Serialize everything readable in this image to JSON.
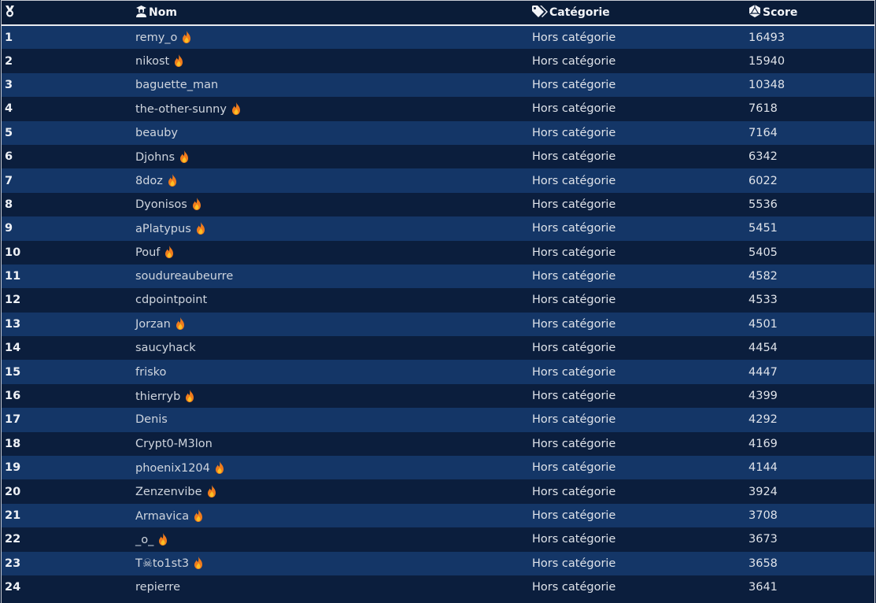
{
  "header": {
    "rank_icon": "medal-icon",
    "name_label": "Nom",
    "name_icon": "user-graduate-icon",
    "category_label": "Catégorie",
    "category_icon": "tags-icon",
    "score_label": "Score",
    "score_icon": "dice-d20-icon"
  },
  "colors": {
    "row_odd": "#143667",
    "row_even": "#0b1e3d",
    "fire": "#f07b1c"
  },
  "rows": [
    {
      "rank": "1",
      "name": "remy_o",
      "fire": true,
      "category": "Hors catégorie",
      "score": "16493"
    },
    {
      "rank": "2",
      "name": "nikost",
      "fire": true,
      "category": "Hors catégorie",
      "score": "15940"
    },
    {
      "rank": "3",
      "name": "baguette_man",
      "fire": false,
      "category": "Hors catégorie",
      "score": "10348"
    },
    {
      "rank": "4",
      "name": "the-other-sunny",
      "fire": true,
      "category": "Hors catégorie",
      "score": "7618"
    },
    {
      "rank": "5",
      "name": "beauby",
      "fire": false,
      "category": "Hors catégorie",
      "score": "7164"
    },
    {
      "rank": "6",
      "name": "Djohns",
      "fire": true,
      "category": "Hors catégorie",
      "score": "6342"
    },
    {
      "rank": "7",
      "name": "8doz",
      "fire": true,
      "category": "Hors catégorie",
      "score": "6022"
    },
    {
      "rank": "8",
      "name": "Dyonisos",
      "fire": true,
      "category": "Hors catégorie",
      "score": "5536"
    },
    {
      "rank": "9",
      "name": "aPlatypus",
      "fire": true,
      "category": "Hors catégorie",
      "score": "5451"
    },
    {
      "rank": "10",
      "name": "Pouf",
      "fire": true,
      "category": "Hors catégorie",
      "score": "5405"
    },
    {
      "rank": "11",
      "name": "soudureaubeurre",
      "fire": false,
      "category": "Hors catégorie",
      "score": "4582"
    },
    {
      "rank": "12",
      "name": "cdpointpoint",
      "fire": false,
      "category": "Hors catégorie",
      "score": "4533"
    },
    {
      "rank": "13",
      "name": "Jorzan",
      "fire": true,
      "category": "Hors catégorie",
      "score": "4501"
    },
    {
      "rank": "14",
      "name": "saucyhack",
      "fire": false,
      "category": "Hors catégorie",
      "score": "4454"
    },
    {
      "rank": "15",
      "name": "frisko",
      "fire": false,
      "category": "Hors catégorie",
      "score": "4447"
    },
    {
      "rank": "16",
      "name": "thierryb",
      "fire": true,
      "category": "Hors catégorie",
      "score": "4399"
    },
    {
      "rank": "17",
      "name": "Denis",
      "fire": false,
      "category": "Hors catégorie",
      "score": "4292"
    },
    {
      "rank": "18",
      "name": "Crypt0-M3lon",
      "fire": false,
      "category": "Hors catégorie",
      "score": "4169"
    },
    {
      "rank": "19",
      "name": "phoenix1204",
      "fire": true,
      "category": "Hors catégorie",
      "score": "4144"
    },
    {
      "rank": "20",
      "name": "Zenzenvibe",
      "fire": true,
      "category": "Hors catégorie",
      "score": "3924"
    },
    {
      "rank": "21",
      "name": "Armavica",
      "fire": true,
      "category": "Hors catégorie",
      "score": "3708"
    },
    {
      "rank": "22",
      "name": "_o_",
      "fire": true,
      "category": "Hors catégorie",
      "score": "3673"
    },
    {
      "rank": "23",
      "name": "T☠to1st3",
      "fire": true,
      "category": "Hors catégorie",
      "score": "3658"
    },
    {
      "rank": "24",
      "name": "repierre",
      "fire": false,
      "category": "Hors catégorie",
      "score": "3641"
    }
  ]
}
